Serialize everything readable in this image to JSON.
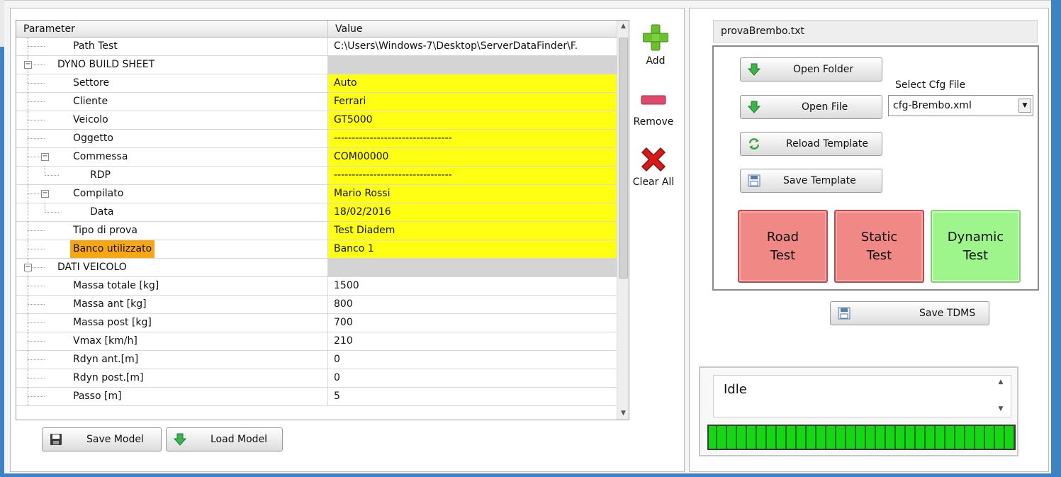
{
  "tree": {
    "columns": {
      "parameter": "Parameter",
      "value": "Value"
    },
    "rows": [
      {
        "label": "Path Test",
        "value": "C:\\Users\\Windows-7\\Desktop\\ServerDataFinder\\F."
      },
      {
        "label": "DYNO BUILD SHEET",
        "value": ""
      },
      {
        "label": "Settore",
        "value": "Auto"
      },
      {
        "label": "Cliente",
        "value": "Ferrari"
      },
      {
        "label": "Veicolo",
        "value": "GT5000"
      },
      {
        "label": "Oggetto",
        "value": "---------------------------------"
      },
      {
        "label": "Commessa",
        "value": "COM00000"
      },
      {
        "label": "RDP",
        "value": "---------------------------------"
      },
      {
        "label": "Compilato",
        "value": "Mario Rossi"
      },
      {
        "label": "Data",
        "value": "18/02/2016"
      },
      {
        "label": "Tipo di prova",
        "value": "Test Diadem"
      },
      {
        "label": "Banco utilizzato",
        "value": "Banco 1"
      },
      {
        "label": "DATI VEICOLO",
        "value": ""
      },
      {
        "label": "Massa totale [kg]",
        "value": "1500"
      },
      {
        "label": "Massa ant [kg]",
        "value": "800"
      },
      {
        "label": "Massa post [kg]",
        "value": "700"
      },
      {
        "label": "Vmax [km/h]",
        "value": "210"
      },
      {
        "label": "Rdyn ant.[m]",
        "value": "0"
      },
      {
        "label": "Rdyn post.[m]",
        "value": "0"
      },
      {
        "label": "Passo [m]",
        "value": "5"
      }
    ]
  },
  "tools": {
    "add": "Add",
    "remove": "Remove",
    "clear_all": "Clear All"
  },
  "left_buttons": {
    "save_model": "Save Model",
    "load_model": "Load Model"
  },
  "file": {
    "current": "provaBrembo.txt"
  },
  "actions": {
    "open_folder": "Open Folder",
    "open_file": "Open File",
    "reload_template": "Reload Template",
    "save_template": "Save Template",
    "save_tdms": "Save TDMS"
  },
  "cfg": {
    "label": "Select Cfg File",
    "selected": "cfg-Brembo.xml"
  },
  "tests": {
    "road": {
      "line1": "Road",
      "line2": "Test",
      "color": "#f08986"
    },
    "static": {
      "line1": "Static",
      "line2": "Test",
      "color": "#f08986"
    },
    "dynamic": {
      "line1": "Dynamic",
      "line2": "Test",
      "color": "#9ef58c"
    }
  },
  "status": {
    "text": "Idle",
    "progress": 1.0
  },
  "colors": {
    "highlight_yellow": "#ffff14",
    "selected_orange": "#f7a711",
    "window_blue": "#3d83c4"
  }
}
